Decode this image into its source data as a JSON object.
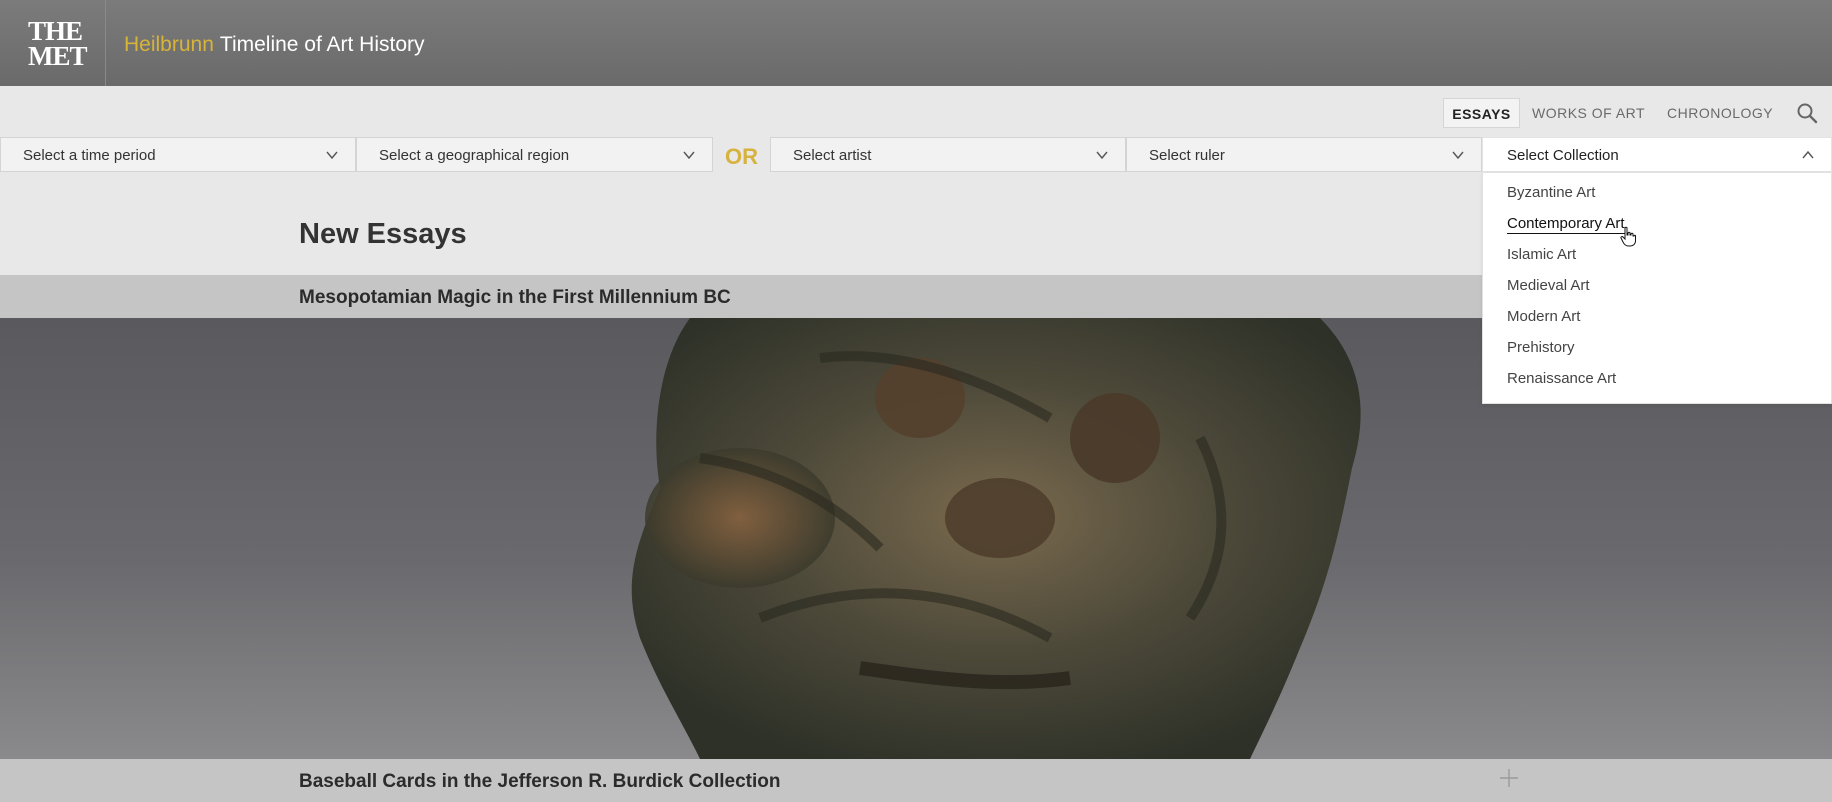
{
  "header": {
    "logo_line1": "THE",
    "logo_line2": "MET",
    "title_highlight": "Heilbrunn",
    "title_rest": "Timeline of Art History"
  },
  "nav": {
    "items": [
      {
        "label": "ESSAYS",
        "active": true
      },
      {
        "label": "WORKS OF ART",
        "active": false
      },
      {
        "label": "CHRONOLOGY",
        "active": false
      }
    ],
    "search_icon": "search-icon"
  },
  "filters": {
    "time_period": "Select a time period",
    "region": "Select a geographical region",
    "or_label": "OR",
    "artist": "Select artist",
    "ruler": "Select ruler",
    "collection": "Select Collection"
  },
  "collection_dropdown": {
    "items": [
      "Byzantine Art",
      "Contemporary Art",
      "Islamic Art",
      "Medieval Art",
      "Modern Art",
      "Prehistory",
      "Renaissance Art"
    ],
    "hovered_index": 1
  },
  "main": {
    "section_title": "New Essays",
    "essays": [
      {
        "title": "Mesopotamian Magic in the First Millennium BC"
      },
      {
        "title": "Baseball Cards in the Jefferson R. Burdick Collection"
      }
    ]
  },
  "colors": {
    "accent_gold": "#d6b23f",
    "header_bg": "#747474",
    "bar_bg": "#c5c5c5"
  }
}
